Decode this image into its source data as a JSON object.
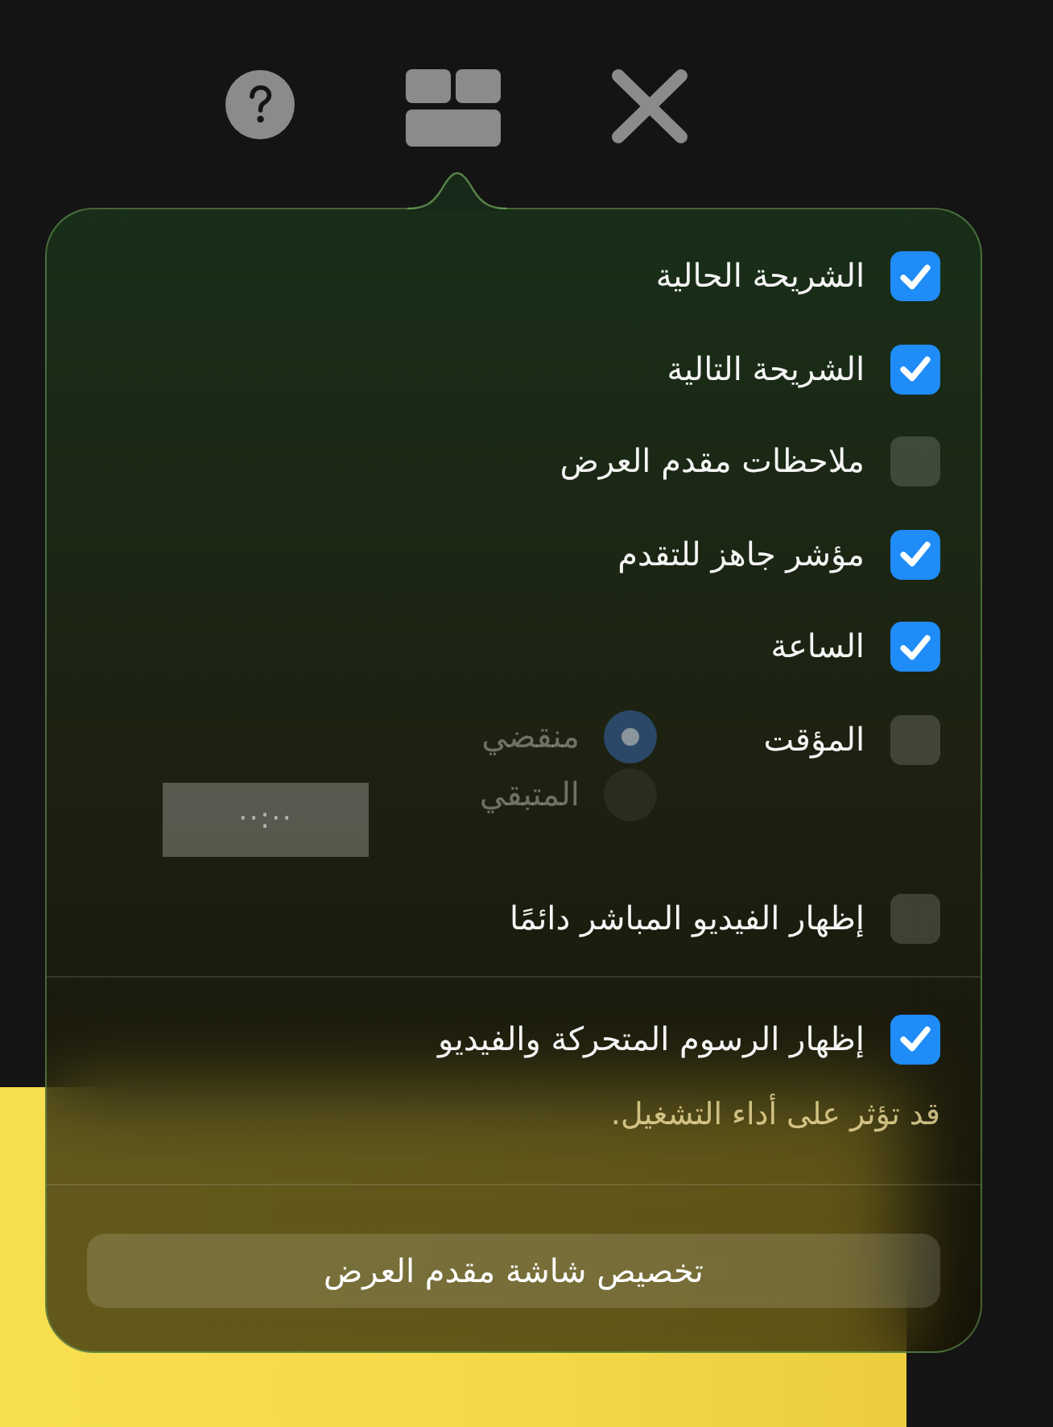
{
  "options": [
    {
      "label": "الشريحة الحالية",
      "checked": true
    },
    {
      "label": "الشريحة التالية",
      "checked": true
    },
    {
      "label": "ملاحظات مقدم العرض",
      "checked": false
    },
    {
      "label": "مؤشر جاهز للتقدم",
      "checked": true
    },
    {
      "label": "الساعة",
      "checked": true
    }
  ],
  "timer": {
    "label": "المؤقت",
    "checked": false,
    "disabled": true,
    "modes": [
      {
        "label": "منقضي",
        "selected": true
      },
      {
        "label": "المتبقي",
        "selected": false
      }
    ],
    "duration": "··:··"
  },
  "live_video": {
    "label": "إظهار الفيديو المباشر دائمًا",
    "checked": false
  },
  "animations": {
    "label": "إظهار الرسوم المتحركة والفيديو",
    "checked": true,
    "note": "قد تؤثر على أداء التشغيل."
  },
  "customize_button": {
    "label": "تخصيص شاشة مقدم العرض"
  }
}
